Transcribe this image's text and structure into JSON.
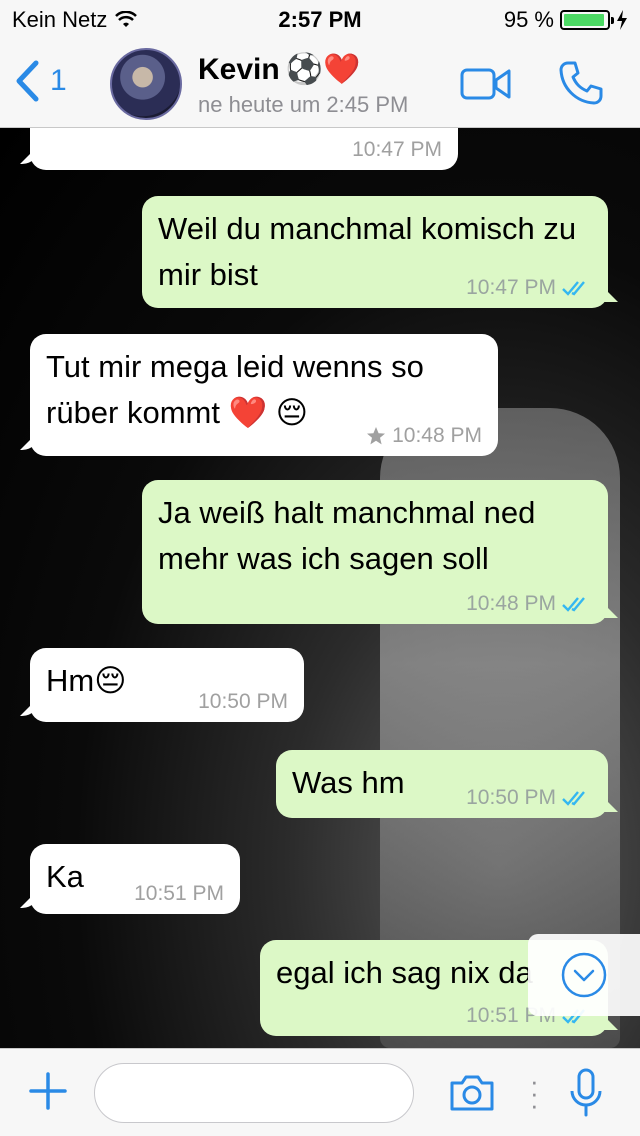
{
  "status_bar": {
    "carrier": "Kein Netz",
    "time": "2:57 PM",
    "battery_text": "95 %",
    "battery_level": 0.95
  },
  "nav": {
    "back_count": "1",
    "contact_name": "Kevin",
    "contact_emojis": "⚽️❤️",
    "last_seen": "ne heute um 2:45 PM"
  },
  "messages": [
    {
      "dir": "in",
      "text": "",
      "time": "10:47 PM",
      "starred": false
    },
    {
      "dir": "out",
      "text": "Weil du manchmal komisch zu mir bist",
      "time": "10:47 PM",
      "read": true
    },
    {
      "dir": "in",
      "text": "Tut mir mega leid wenns so rüber kommt ❤️ 😔",
      "time": "10:48 PM",
      "starred": true
    },
    {
      "dir": "out",
      "text": "Ja weiß halt manchmal ned mehr was ich sagen soll",
      "time": "10:48 PM",
      "read": true
    },
    {
      "dir": "in",
      "text": "Hm😔",
      "time": "10:50 PM",
      "starred": false
    },
    {
      "dir": "out",
      "text": "Was hm",
      "time": "10:50 PM",
      "read": true
    },
    {
      "dir": "in",
      "text": "Ka",
      "time": "10:51 PM",
      "starred": false
    },
    {
      "dir": "out",
      "text": "egal ich sag nix da",
      "time": "10:51 PM",
      "read": true
    }
  ],
  "input": {
    "value": "",
    "placeholder": ""
  },
  "colors": {
    "accent": "#2a8ae6",
    "outgoing_bubble": "#dcf8c6",
    "incoming_bubble": "#ffffff",
    "read_ticks": "#34b7f1",
    "battery": "#4cd964"
  },
  "icons": [
    "back-chevron-icon",
    "video-call-icon",
    "phone-icon",
    "wifi-icon",
    "charging-icon",
    "star-icon",
    "double-check-icon",
    "chevron-down-icon",
    "plus-icon",
    "camera-icon",
    "microphone-icon"
  ]
}
